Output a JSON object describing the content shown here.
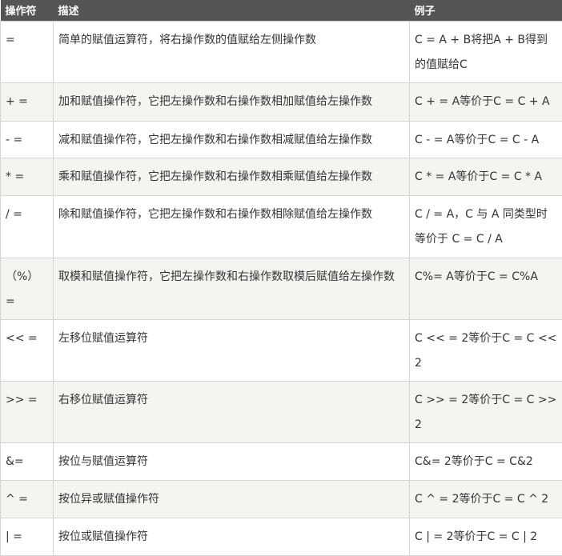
{
  "header": {
    "col1": "操作符",
    "col2": "描述",
    "col3": "例子"
  },
  "rows": [
    {
      "op": "=",
      "desc": "简单的赋值运算符，将右操作数的值赋给左侧操作数",
      "example": "C = A + B将把A + B得到的值赋给C"
    },
    {
      "op": "+ =",
      "desc": "加和赋值操作符，它把左操作数和右操作数相加赋值给左操作数",
      "example": "C + = A等价于C = C + A"
    },
    {
      "op": "- =",
      "desc": "减和赋值操作符，它把左操作数和右操作数相减赋值给左操作数",
      "example": "C - = A等价于C = C - A"
    },
    {
      "op": "* =",
      "desc": "乘和赋值操作符，它把左操作数和右操作数相乘赋值给左操作数",
      "example": "C * = A等价于C = C * A"
    },
    {
      "op": "/ =",
      "desc": "除和赋值操作符，它把左操作数和右操作数相除赋值给左操作数",
      "example": "C / = A，C 与 A 同类型时等价于 C = C / A"
    },
    {
      "op": "（%）=",
      "desc": "取模和赋值操作符，它把左操作数和右操作数取模后赋值给左操作数",
      "example": "C%= A等价于C = C%A"
    },
    {
      "op": "<< =",
      "desc": "左移位赋值运算符",
      "example": "C << = 2等价于C = C << 2"
    },
    {
      "op": ">> =",
      "desc": "右移位赋值运算符",
      "example": "C >> = 2等价于C = C >> 2"
    },
    {
      "op": "&=",
      "desc": "按位与赋值运算符",
      "example": "C&= 2等价于C = C&2"
    },
    {
      "op": "^ =",
      "desc": "按位异或赋值操作符",
      "example": "C ^ = 2等价于C = C ^ 2"
    },
    {
      "op": "| =",
      "desc": "按位或赋值操作符",
      "example": "C | = 2等价于C = C | 2"
    }
  ],
  "colors": {
    "header_bg": "#555555",
    "header_text": "#ffffff",
    "row_alt_bg": "#f6f4f0",
    "border": "#d4d4d4",
    "text": "#333333"
  }
}
